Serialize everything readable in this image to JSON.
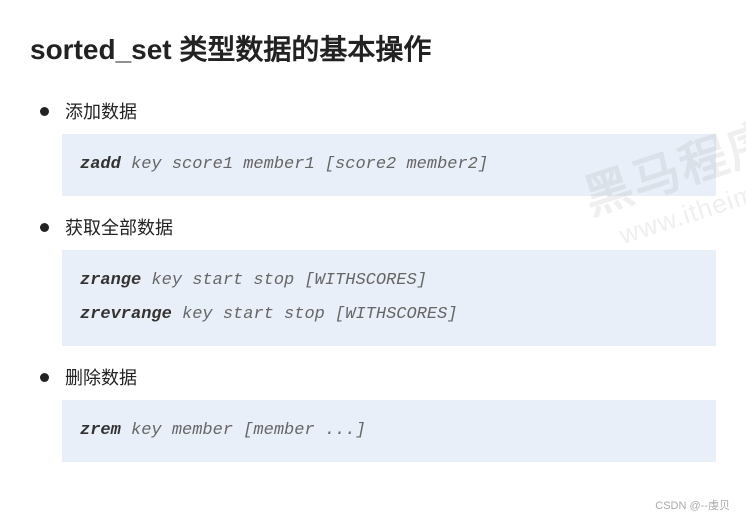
{
  "title": "sorted_set 类型数据的基本操作",
  "sections": [
    {
      "label": "添加数据",
      "code": [
        {
          "cmd": "zadd",
          "args": " key score1 member1 [score2 member2]"
        }
      ]
    },
    {
      "label": "获取全部数据",
      "code": [
        {
          "cmd": "zrange",
          "args": " key start stop [WITHSCORES]"
        },
        {
          "cmd": "zrevrange",
          "args": " key start stop [WITHSCORES]"
        }
      ]
    },
    {
      "label": "删除数据",
      "code": [
        {
          "cmd": "zrem",
          "args": " key member [member ...]"
        }
      ]
    }
  ],
  "watermark": {
    "main": "黑马程序",
    "sub": "www.itheima"
  },
  "footer": "CSDN @--虔贝"
}
